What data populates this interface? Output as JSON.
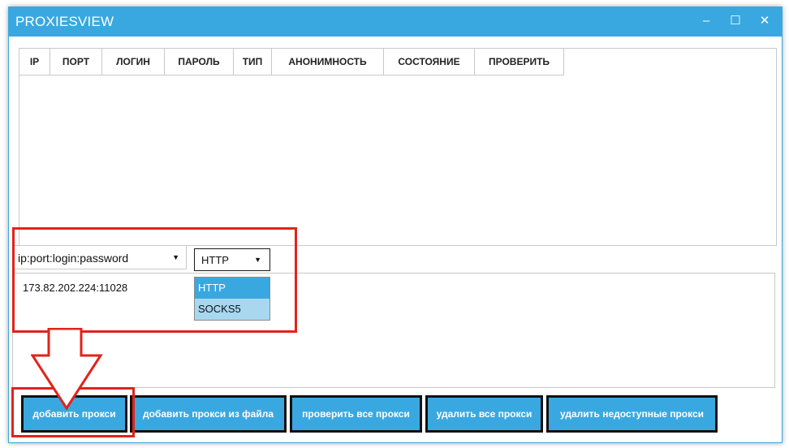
{
  "window": {
    "title": "PROXIESVIEW"
  },
  "title_controls": {
    "minimize": "–",
    "maximize": "☐",
    "close": "✕"
  },
  "grid": {
    "columns": [
      "IP",
      "ПОРТ",
      "ЛОГИН",
      "ПАРОЛЬ",
      "ТИП",
      "АНОНИМНОСТЬ",
      "СОСТОЯНИЕ",
      "ПРОВЕРИТЬ"
    ]
  },
  "format_select": {
    "value": "ip:port:login:password"
  },
  "type_select": {
    "value": "HTTP",
    "options": [
      "HTTP",
      "SOCKS5"
    ]
  },
  "proxy_input": {
    "value": "173.82.202.224:11028"
  },
  "buttons": {
    "add": "добавить прокси",
    "add_from_file": "добавить прокси из файла",
    "check_all": "проверить все прокси",
    "delete_all": "удалить все прокси",
    "delete_unavailable": "удалить недоступные прокси"
  },
  "colors": {
    "accent": "#3aa8e0",
    "highlight": "#e2231a",
    "option_selected": "#3aa8e0",
    "option_hover": "#a8d8f0"
  },
  "icons": {
    "dropdown_arrow": "▼"
  }
}
